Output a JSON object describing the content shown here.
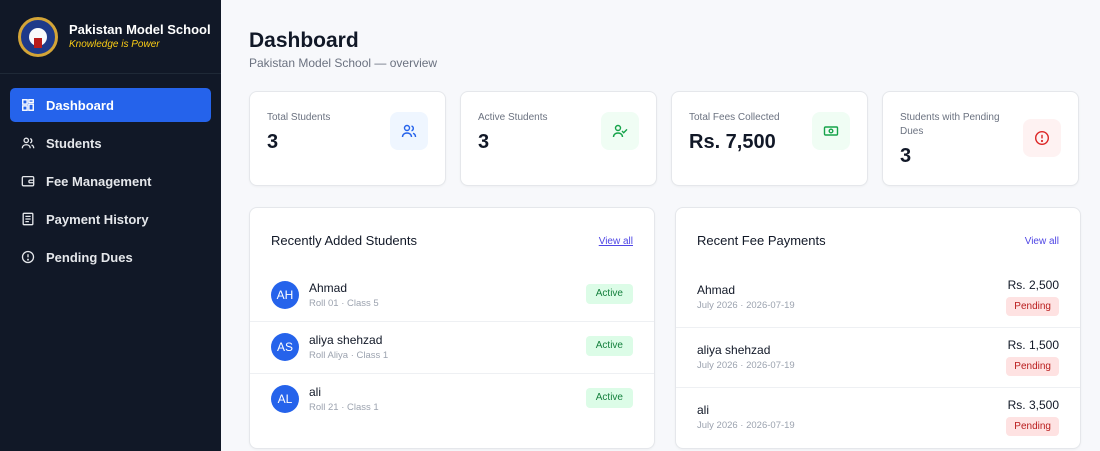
{
  "brand": {
    "name": "Pakistan Model School",
    "tagline": "Knowledge is Power"
  },
  "nav": [
    {
      "label": "Dashboard",
      "icon": "dashboard-grid-icon",
      "active": true
    },
    {
      "label": "Students",
      "icon": "users-icon",
      "active": false
    },
    {
      "label": "Fee Management",
      "icon": "wallet-icon",
      "active": false
    },
    {
      "label": "Payment History",
      "icon": "receipt-icon",
      "active": false
    },
    {
      "label": "Pending Dues",
      "icon": "alert-circle-icon",
      "active": false
    }
  ],
  "page": {
    "title": "Dashboard",
    "subtitle": "Pakistan Model School — overview"
  },
  "stats": [
    {
      "label": "Total Students",
      "value": "3",
      "icon": "users-icon",
      "color": "#2563eb",
      "bg": "#eff6ff"
    },
    {
      "label": "Active Students",
      "value": "3",
      "icon": "user-check-icon",
      "color": "#16a34a",
      "bg": "#f0fdf4"
    },
    {
      "label": "Total Fees Collected",
      "value": "Rs. 7,500",
      "icon": "banknote-icon",
      "color": "#16a34a",
      "bg": "#f0fdf4"
    },
    {
      "label": "Students with Pending Dues",
      "value": "3",
      "icon": "alert-circle-icon",
      "color": "#dc2626",
      "bg": "#fef2f2"
    }
  ],
  "recent_students": {
    "title": "Recently Added Students",
    "view_all": "View all",
    "rows": [
      {
        "initials": "AH",
        "name": "Ahmad",
        "meta": "Roll 01 · Class 5",
        "status": "Active"
      },
      {
        "initials": "AS",
        "name": "aliya shehzad",
        "meta": "Roll Aliya · Class 1",
        "status": "Active"
      },
      {
        "initials": "AL",
        "name": "ali",
        "meta": "Roll 21 · Class 1",
        "status": "Active"
      }
    ]
  },
  "recent_payments": {
    "title": "Recent Fee Payments",
    "view_all": "View all",
    "rows": [
      {
        "name": "Ahmad",
        "meta": "July 2026 · 2026-07-19",
        "amount": "Rs. 2,500",
        "status": "Pending"
      },
      {
        "name": "aliya shehzad",
        "meta": "July 2026 · 2026-07-19",
        "amount": "Rs. 1,500",
        "status": "Pending"
      },
      {
        "name": "ali",
        "meta": "July 2026 · 2026-07-19",
        "amount": "Rs. 3,500",
        "status": "Pending"
      }
    ]
  },
  "colors": {
    "sidebar": "#111827",
    "accent": "#2563eb",
    "brand_tagline": "#facc15"
  }
}
